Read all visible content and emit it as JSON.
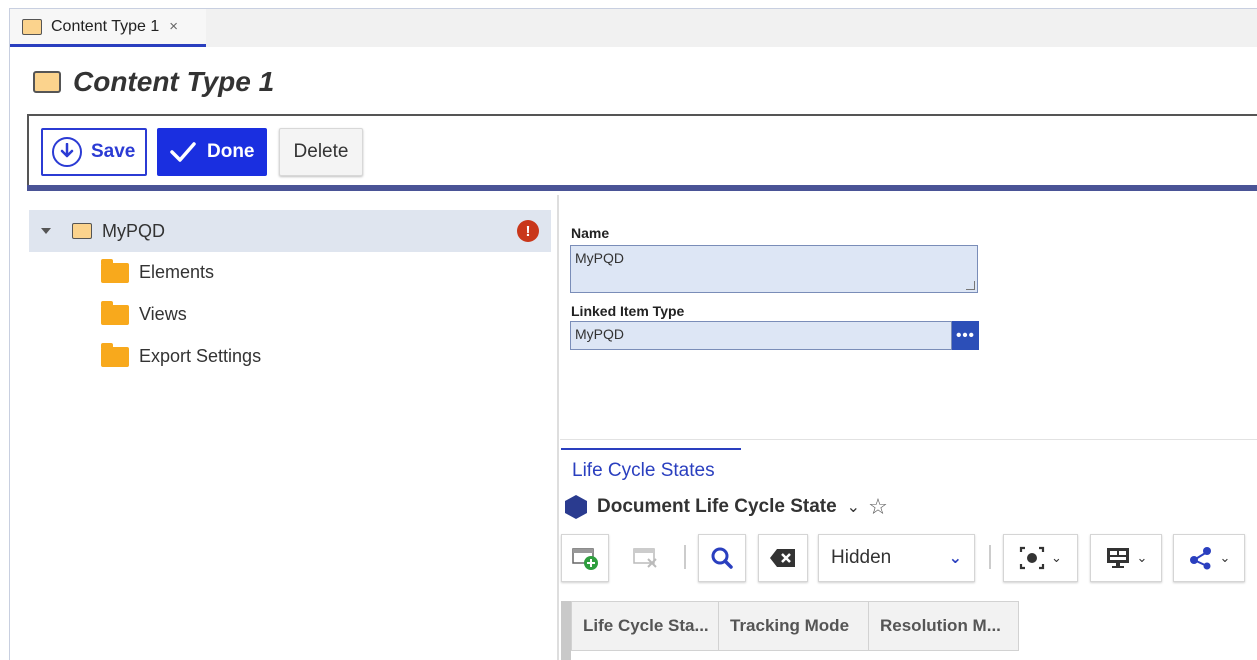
{
  "tab": {
    "label": "Content Type 1",
    "close": "×"
  },
  "header": {
    "title": "Content Type 1"
  },
  "toolbar": {
    "save_label": "Save",
    "done_label": "Done",
    "delete_label": "Delete"
  },
  "tree": {
    "root_label": "MyPQD",
    "error_symbol": "!",
    "children": [
      {
        "label": "Elements"
      },
      {
        "label": "Views"
      },
      {
        "label": "Export Settings"
      }
    ]
  },
  "form": {
    "name_label": "Name",
    "name_value": "MyPQD",
    "linked_item_label": "Linked Item Type",
    "linked_item_value": "MyPQD",
    "dots": "•••"
  },
  "lifecycle": {
    "tab_title": "Life Cycle States",
    "state_label": "Document Life Cycle State",
    "filter_select": "Hidden",
    "columns": [
      "Life Cycle Sta...",
      "Tracking Mode",
      "Resolution M..."
    ]
  },
  "colors": {
    "accent": "#2a3fbf",
    "primary_button": "#1a2fe0",
    "folder": "#f8a91c",
    "error": "#c9371a"
  }
}
